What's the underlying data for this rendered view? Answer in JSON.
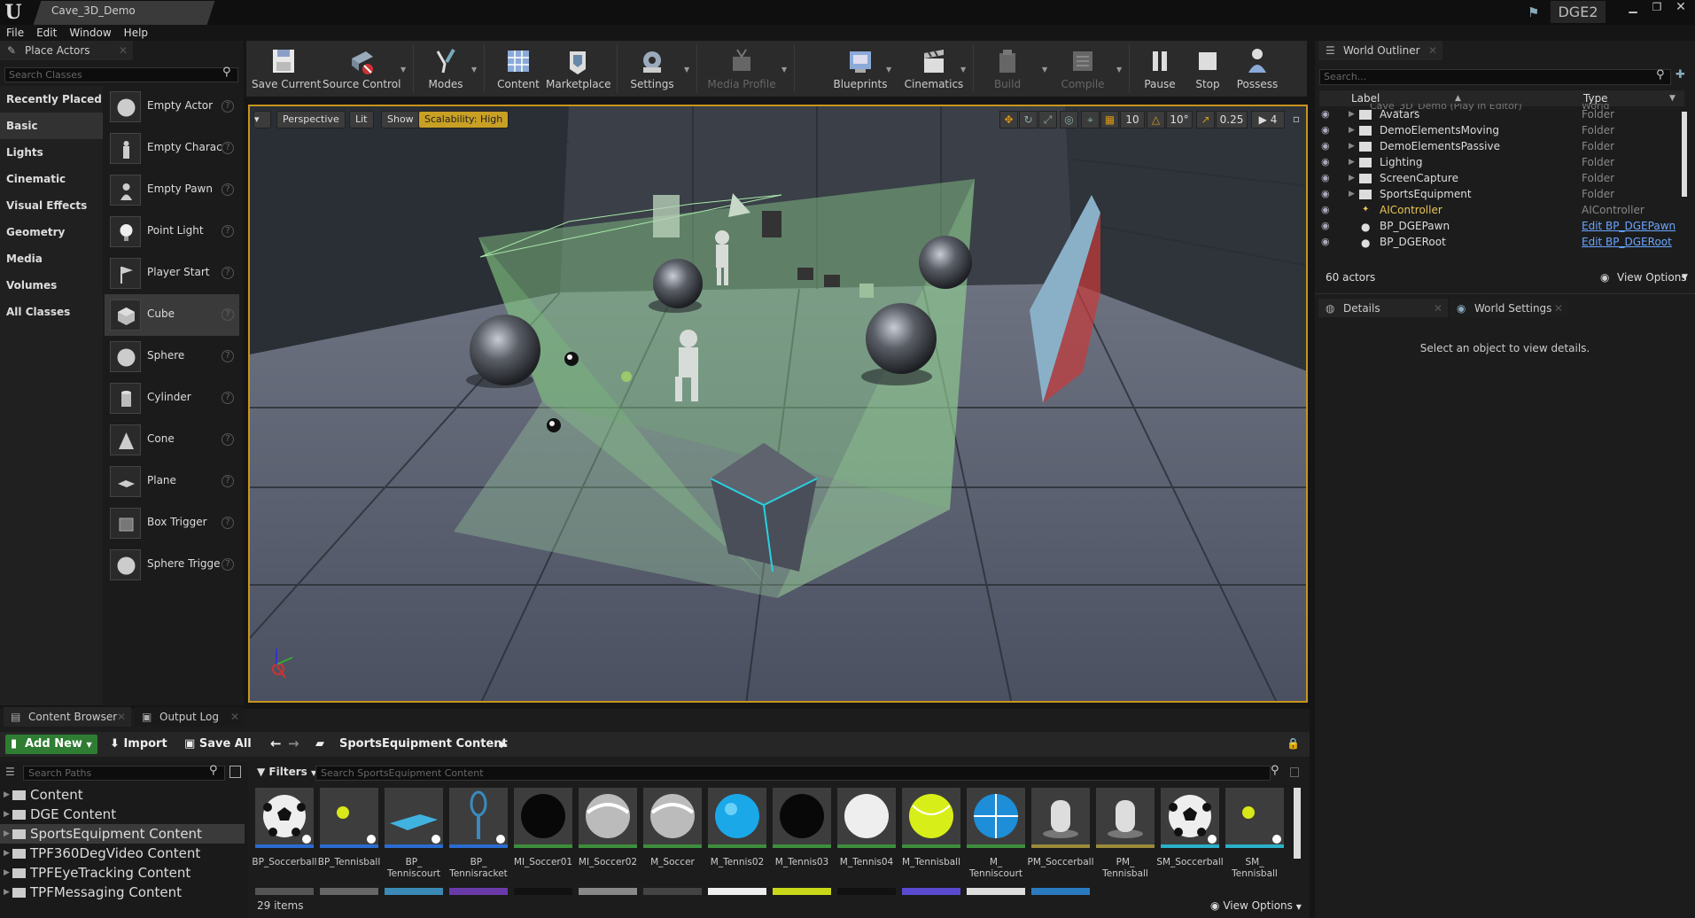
{
  "window": {
    "title": "Cave_3D_Demo",
    "project": "DGE2"
  },
  "menu": [
    "File",
    "Edit",
    "Window",
    "Help"
  ],
  "place_actors": {
    "tab_label": "Place Actors",
    "search_placeholder": "Search Classes",
    "categories": [
      "Recently Placed",
      "Basic",
      "Lights",
      "Cinematic",
      "Visual Effects",
      "Geometry",
      "Media",
      "Volumes",
      "All Classes"
    ],
    "selected_category": "Basic",
    "actors": [
      "Empty Actor",
      "Empty Charac",
      "Empty Pawn",
      "Point Light",
      "Player Start",
      "Cube",
      "Sphere",
      "Cylinder",
      "Cone",
      "Plane",
      "Box Trigger",
      "Sphere Trigge"
    ],
    "selected_actor": "Cube"
  },
  "toolbar": {
    "save": "Save Current",
    "source_control": "Source Control",
    "modes": "Modes",
    "content": "Content",
    "marketplace": "Marketplace",
    "settings": "Settings",
    "media_profile": "Media Profile",
    "blueprints": "Blueprints",
    "cinematics": "Cinematics",
    "build": "Build",
    "compile": "Compile",
    "pause": "Pause",
    "stop": "Stop",
    "possess": "Possess"
  },
  "viewport": {
    "perspective": "Perspective",
    "lit": "Lit",
    "show": "Show",
    "scalability": "Scalability: High",
    "grid_snap": "10",
    "rot_snap": "10°",
    "scale_snap": "0.25",
    "cam_speed": "4"
  },
  "world_outliner": {
    "tab_label": "World Outliner",
    "search_placeholder": "Search...",
    "col_label": "Label",
    "col_type": "Type",
    "root": {
      "name": "Cave_3D_Demo (Play In Editor)",
      "type": "World"
    },
    "rows": [
      {
        "name": "Avatars",
        "type": "Folder",
        "kind": "folder"
      },
      {
        "name": "DemoElementsMoving",
        "type": "Folder",
        "kind": "folder"
      },
      {
        "name": "DemoElementsPassive",
        "type": "Folder",
        "kind": "folder"
      },
      {
        "name": "Lighting",
        "type": "Folder",
        "kind": "folder"
      },
      {
        "name": "ScreenCapture",
        "type": "Folder",
        "kind": "folder"
      },
      {
        "name": "SportsEquipment",
        "type": "Folder",
        "kind": "folder"
      },
      {
        "name": "AIController",
        "type": "AIController",
        "kind": "ai"
      },
      {
        "name": "BP_DGEPawn",
        "type": "Edit BP_DGEPawn",
        "kind": "bp"
      },
      {
        "name": "BP_DGERoot",
        "type": "Edit BP_DGERoot",
        "kind": "bp"
      }
    ],
    "actor_count": "60 actors",
    "view_options": "View Options"
  },
  "details": {
    "tab_label": "Details",
    "world_settings": "World Settings",
    "empty_msg": "Select an object to view details."
  },
  "content_browser": {
    "tab_label": "Content Browser",
    "output_log": "Output Log",
    "add_new": "Add New",
    "import": "Import",
    "save_all": "Save All",
    "breadcrumb": "SportsEquipment Content",
    "search_paths": "Search Paths",
    "filters": "Filters",
    "search_assets": "Search SportsEquipment Content",
    "paths": [
      "Content",
      "DGE Content",
      "SportsEquipment Content",
      "TPF360DegVideo Content",
      "TPFEyeTracking Content",
      "TPFMessaging Content"
    ],
    "selected_path": "SportsEquipment Content",
    "assets": [
      {
        "name": "BP_Soccerball",
        "bar": "#2a6bd1",
        "kind": "soccer"
      },
      {
        "name": "BP_Tennisball",
        "bar": "#2a6bd1",
        "kind": "tennis"
      },
      {
        "name": "BP_\nTenniscourt",
        "bar": "#2a6bd1",
        "kind": "court"
      },
      {
        "name": "BP_\nTennisracket",
        "bar": "#2a6bd1",
        "kind": "racket"
      },
      {
        "name": "MI_Soccer01",
        "bar": "#3c8e3c",
        "kind": "black"
      },
      {
        "name": "MI_Soccer02",
        "bar": "#3c8e3c",
        "kind": "chrome"
      },
      {
        "name": "M_Soccer",
        "bar": "#3c8e3c",
        "kind": "chrome"
      },
      {
        "name": "M_Tennis02",
        "bar": "#3c8e3c",
        "kind": "cyan"
      },
      {
        "name": "M_Tennis03",
        "bar": "#3c8e3c",
        "kind": "black"
      },
      {
        "name": "M_Tennis04",
        "bar": "#3c8e3c",
        "kind": "white"
      },
      {
        "name": "M_Tennisball",
        "bar": "#3c8e3c",
        "kind": "yellow"
      },
      {
        "name": "M_\nTenniscourt",
        "bar": "#3c8e3c",
        "kind": "blueball"
      },
      {
        "name": "PM_Soccerball",
        "bar": "#9a8a3a",
        "kind": "pm"
      },
      {
        "name": "PM_\nTennisball",
        "bar": "#9a8a3a",
        "kind": "pm"
      },
      {
        "name": "SM_Soccerball",
        "bar": "#2ab0c8",
        "kind": "soccer"
      },
      {
        "name": "SM_\nTennisball",
        "bar": "#2ab0c8",
        "kind": "tennis"
      }
    ],
    "item_count": "29 items",
    "view_options": "View Options"
  },
  "colors": {
    "accent": "#c7941e",
    "link": "#6aa6ff",
    "ai_text": "#e8c455",
    "addnew": "#2e7d32"
  }
}
